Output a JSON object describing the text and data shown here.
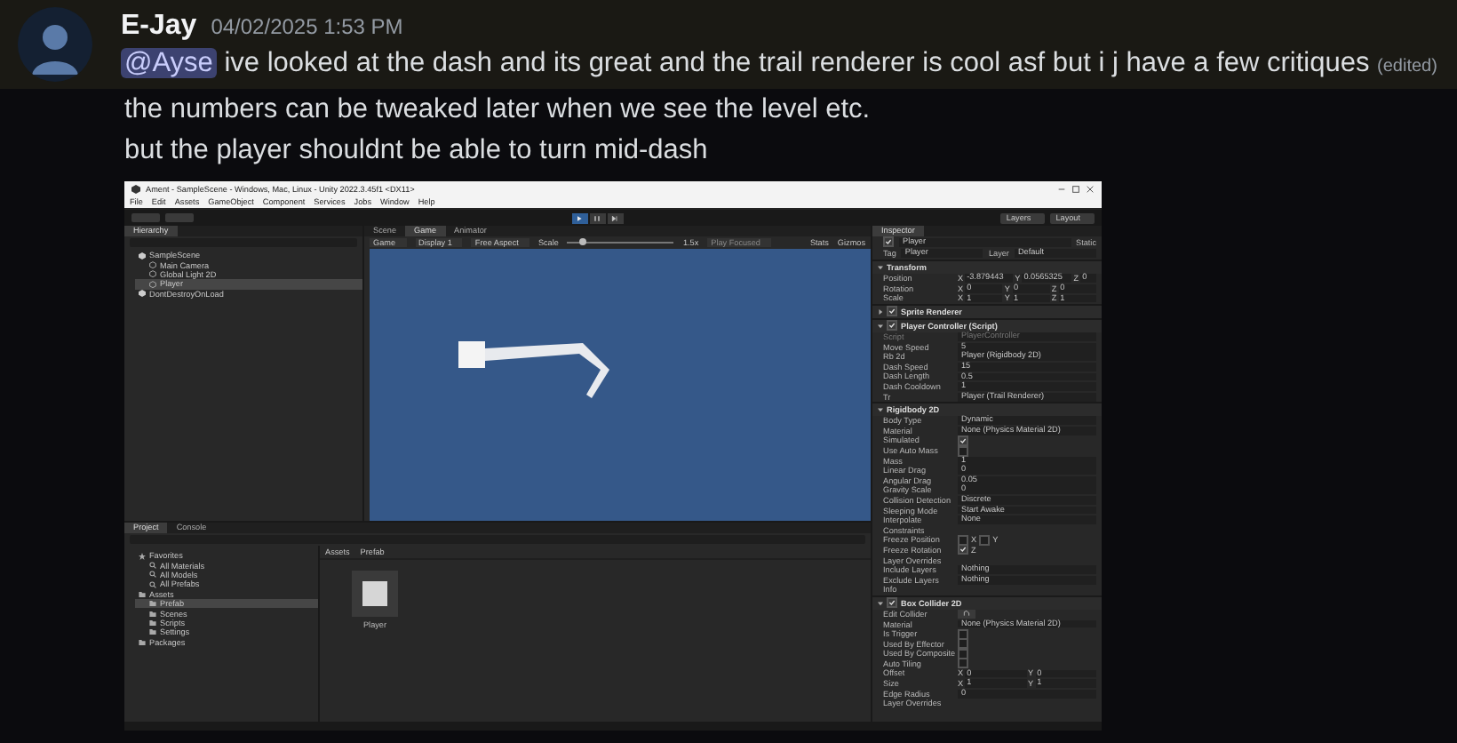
{
  "message": {
    "author": "E-Jay",
    "timestamp": "04/02/2025 1:53 PM",
    "mention": "@Ayse",
    "text": "ive looked at the dash and its great and the trail renderer is cool asf but i j have a few critiques",
    "edited": "(edited)",
    "highlighted": true
  },
  "followups": [
    "the numbers can be tweaked later when we see the level etc.",
    "but the player shouldnt be able to turn mid-dash"
  ],
  "attachment": {
    "title": "Ament - SampleScene - Windows, Mac, Linux - Unity 2022.3.45f1 <DX11>",
    "menu": [
      "File",
      "Edit",
      "Assets",
      "GameObject",
      "Component",
      "Services",
      "Jobs",
      "Window",
      "Help"
    ],
    "playing": true,
    "toolbar_right": [
      "Layers",
      "Layout"
    ],
    "hierarchy": {
      "tab": "Hierarchy",
      "items": [
        {
          "label": "SampleScene",
          "kind": "scene",
          "selected": false,
          "children": [
            {
              "label": "Main Camera",
              "kind": "object",
              "selected": false
            },
            {
              "label": "Global Light 2D",
              "kind": "object",
              "selected": false
            },
            {
              "label": "Player",
              "kind": "object",
              "selected": true
            }
          ]
        },
        {
          "label": "DontDestroyOnLoad",
          "kind": "scene",
          "selected": false
        }
      ]
    },
    "view_tabs": [
      {
        "label": "Scene",
        "selected": false
      },
      {
        "label": "Game",
        "selected": true
      },
      {
        "label": "Animator",
        "selected": false
      }
    ],
    "game_bar": {
      "mode": "Game",
      "display": "Display 1",
      "aspect": "Free Aspect",
      "scale_label": "Scale",
      "scale_value": "1.5x",
      "scale_slider": {
        "level": 0.15
      },
      "play_mode": "Play Focused",
      "stats": "Stats",
      "gizmos": "Gizmos"
    },
    "inspector": {
      "tab": "Inspector",
      "object": "Player",
      "active": true,
      "static": "Static",
      "tag_label": "Tag",
      "tag": "Player",
      "layer_label": "Layer",
      "layer": "Default",
      "components": [
        {
          "title": "Transform",
          "kind": "component",
          "expanded": true,
          "rows": [
            {
              "label": "Position",
              "kind": "vector",
              "values": [
                {
                  "axis": "X",
                  "value": "-3.879443"
                },
                {
                  "axis": "Y",
                  "value": "0.0565325"
                },
                {
                  "axis": "Z",
                  "value": "0"
                }
              ]
            },
            {
              "label": "Rotation",
              "kind": "vector",
              "values": [
                {
                  "axis": "X",
                  "value": "0"
                },
                {
                  "axis": "Y",
                  "value": "0"
                },
                {
                  "axis": "Z",
                  "value": "0"
                }
              ]
            },
            {
              "label": "Scale",
              "kind": "vector",
              "values": [
                {
                  "axis": "X",
                  "value": "1"
                },
                {
                  "axis": "Y",
                  "value": "1"
                },
                {
                  "axis": "Z",
                  "value": "1"
                }
              ]
            }
          ]
        },
        {
          "title": "Sprite Renderer",
          "kind": "behaviour",
          "enabled": true,
          "expanded": false
        },
        {
          "title": "Player Controller (Script)",
          "kind": "behaviour",
          "enabled": true,
          "expanded": true,
          "rows": [
            {
              "label": "Script",
              "kind": "object",
              "value": "PlayerController",
              "disabled": true
            },
            {
              "label": "Move Speed",
              "kind": "value",
              "value": "5"
            },
            {
              "label": "Rb 2d",
              "kind": "object",
              "value": "Player (Rigidbody 2D)"
            },
            {
              "label": "Dash Speed",
              "kind": "value",
              "value": "15"
            },
            {
              "label": "Dash Length",
              "kind": "value",
              "value": "0.5"
            },
            {
              "label": "Dash Cooldown",
              "kind": "value",
              "value": "1"
            },
            {
              "label": "Tr",
              "kind": "object",
              "value": "Player (Trail Renderer)"
            }
          ]
        },
        {
          "title": "Rigidbody 2D",
          "kind": "component",
          "expanded": true,
          "rows": [
            {
              "label": "Body Type",
              "kind": "dropdown",
              "value": "Dynamic"
            },
            {
              "label": "Material",
              "kind": "object",
              "value": "None (Physics Material 2D)"
            },
            {
              "label": "Simulated",
              "kind": "check",
              "checked": true
            },
            {
              "label": "Use Auto Mass",
              "kind": "check",
              "checked": false
            },
            {
              "label": "Mass",
              "kind": "value",
              "value": "1"
            },
            {
              "label": "Linear Drag",
              "kind": "value",
              "value": "0"
            },
            {
              "label": "Angular Drag",
              "kind": "value",
              "value": "0.05"
            },
            {
              "label": "Gravity Scale",
              "kind": "value",
              "value": "0"
            },
            {
              "label": "Collision Detection",
              "kind": "dropdown",
              "value": "Discrete"
            },
            {
              "label": "Sleeping Mode",
              "kind": "dropdown",
              "value": "Start Awake"
            },
            {
              "label": "Interpolate",
              "kind": "dropdown",
              "value": "None"
            },
            {
              "label": "Constraints",
              "kind": "foldout"
            },
            {
              "label": "Freeze Position",
              "kind": "axes",
              "values": [
                {
                  "axis": "X",
                  "checked": false
                },
                {
                  "axis": "Y",
                  "checked": false
                }
              ]
            },
            {
              "label": "Freeze Rotation",
              "kind": "axes",
              "values": [
                {
                  "axis": "Z",
                  "checked": true
                }
              ]
            },
            {
              "label": "Layer Overrides",
              "kind": "foldout"
            },
            {
              "label": "Include Layers",
              "kind": "dropdown",
              "value": "Nothing"
            },
            {
              "label": "Exclude Layers",
              "kind": "dropdown",
              "value": "Nothing"
            },
            {
              "label": "Info",
              "kind": "foldout"
            }
          ]
        },
        {
          "title": "Box Collider 2D",
          "kind": "behaviour",
          "enabled": true,
          "expanded": true,
          "rows": [
            {
              "label": "Edit Collider",
              "kind": "button"
            },
            {
              "label": "Material",
              "kind": "object",
              "value": "None (Physics Material 2D)"
            },
            {
              "label": "Is Trigger",
              "kind": "check",
              "checked": false
            },
            {
              "label": "Used By Effector",
              "kind": "check",
              "checked": false
            },
            {
              "label": "Used By Composite",
              "kind": "check",
              "checked": false
            },
            {
              "label": "Auto Tiling",
              "kind": "check",
              "checked": false
            },
            {
              "label": "Offset",
              "kind": "vector",
              "values": [
                {
                  "axis": "X",
                  "value": "0"
                },
                {
                  "axis": "Y",
                  "value": "0"
                }
              ]
            },
            {
              "label": "Size",
              "kind": "vector",
              "values": [
                {
                  "axis": "X",
                  "value": "1"
                },
                {
                  "axis": "Y",
                  "value": "1"
                }
              ]
            },
            {
              "label": "Edge Radius",
              "kind": "value",
              "value": "0"
            },
            {
              "label": "Layer Overrides",
              "kind": "foldout"
            }
          ]
        }
      ]
    },
    "project": {
      "tabs": [
        {
          "label": "Project",
          "selected": true
        },
        {
          "label": "Console",
          "selected": false
        }
      ],
      "tree": [
        {
          "label": "Favorites",
          "kind": "favorites",
          "selected": false,
          "children": [
            {
              "label": "All Materials",
              "kind": "search",
              "selected": false
            },
            {
              "label": "All Models",
              "kind": "search",
              "selected": false
            },
            {
              "label": "All Prefabs",
              "kind": "search",
              "selected": false
            }
          ]
        },
        {
          "label": "Assets",
          "kind": "folder",
          "selected": false,
          "children": [
            {
              "label": "Prefab",
              "kind": "folder",
              "selected": true
            },
            {
              "label": "Scenes",
              "kind": "folder",
              "selected": false
            },
            {
              "label": "Scripts",
              "kind": "folder",
              "selected": false
            },
            {
              "label": "Settings",
              "kind": "folder",
              "selected": false
            }
          ]
        },
        {
          "label": "Packages",
          "kind": "folder",
          "selected": false
        }
      ],
      "breadcrumb": [
        "Assets",
        "Prefab"
      ],
      "assets": [
        {
          "label": "Player"
        }
      ]
    }
  }
}
